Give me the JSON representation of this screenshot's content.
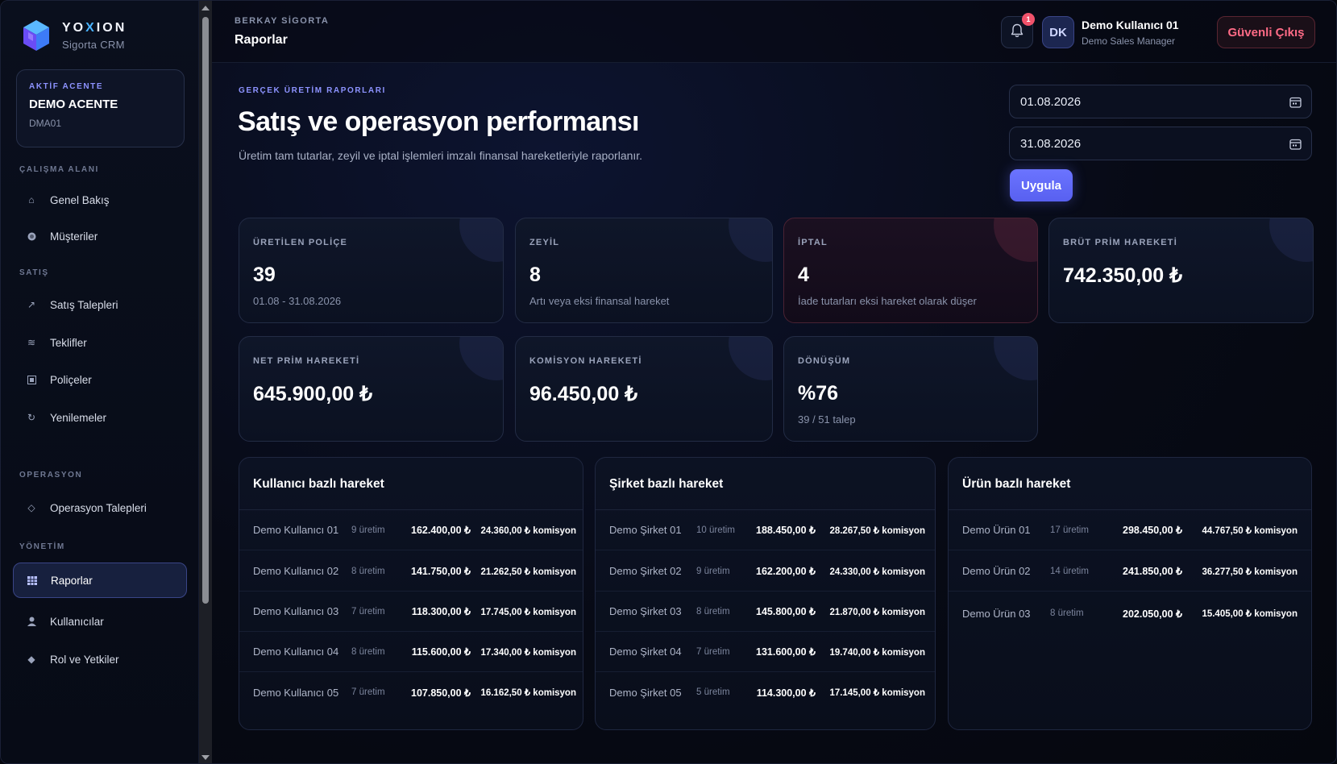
{
  "brand": {
    "name_pre": "YO",
    "name_x": "X",
    "name_post": "ION",
    "subtitle": "Sigorta CRM"
  },
  "agency": {
    "kicker": "AKTİF ACENTE",
    "name": "DEMO ACENTE",
    "code": "DMA01"
  },
  "nav": {
    "sections": [
      {
        "label": "ÇALIŞMA ALANI"
      },
      {
        "label": "SATIŞ"
      },
      {
        "label": "OPERASYON"
      },
      {
        "label": "YÖNETİM"
      }
    ],
    "items": [
      {
        "label": "Genel Bakış",
        "icon": "home-icon"
      },
      {
        "label": "Müşteriler",
        "icon": "customers-icon"
      },
      {
        "label": "Satış Talepleri",
        "icon": "trend-arrow-icon"
      },
      {
        "label": "Teklifler",
        "icon": "wave-icon"
      },
      {
        "label": "Poliçeler",
        "icon": "document-icon"
      },
      {
        "label": "Yenilemeler",
        "icon": "refresh-icon"
      },
      {
        "label": "Operasyon Talepleri",
        "icon": "diamond-icon"
      },
      {
        "label": "Raporlar",
        "icon": "report-grid-icon",
        "active": true
      },
      {
        "label": "Kullanıcılar",
        "icon": "user-icon"
      },
      {
        "label": "Rol ve Yetkiler",
        "icon": "roles-diamond-icon"
      }
    ]
  },
  "topbar": {
    "kicker": "BERKAY SİGORTA",
    "title": "Raporlar",
    "notification_count": "1",
    "user": {
      "initials": "DK",
      "name": "Demo Kullanıcı 01",
      "role": "Demo Sales Manager"
    },
    "logout_label": "Güvenli Çıkış"
  },
  "header": {
    "kicker": "GERÇEK ÜRETİM RAPORLARI",
    "title": "Satış ve operasyon performansı",
    "lead": "Üretim tam tutarlar, zeyil ve iptal işlemleri imzalı finansal hareketleriyle raporlanır."
  },
  "filters": {
    "start_date": "01.08.2026",
    "end_date": "31.08.2026",
    "apply_label": "Uygula"
  },
  "stats": [
    {
      "label": "ÜRETİLEN POLİÇE",
      "value": "39",
      "note": "01.08 - 31.08.2026"
    },
    {
      "label": "ZEYİL",
      "value": "8",
      "note": "Artı veya eksi finansal hareket"
    },
    {
      "label": "İPTAL",
      "value": "4",
      "note": "İade tutarları eksi hareket olarak düşer"
    },
    {
      "label": "BRÜT PRİM HAREKETİ",
      "value": "742.350,00 ₺",
      "note": ""
    },
    {
      "label": "NET PRİM HAREKETİ",
      "value": "645.900,00 ₺",
      "note": ""
    },
    {
      "label": "KOMİSYON HAREKETİ",
      "value": "96.450,00 ₺",
      "note": ""
    },
    {
      "label": "DÖNÜŞÜM",
      "value": "%76",
      "note": "39 / 51 talep"
    }
  ],
  "panels": [
    {
      "title": "Kullanıcı bazlı hareket",
      "rows": [
        {
          "name": "Demo Kullanıcı 01",
          "count": "9 üretim",
          "amount": "162.400,00 ₺",
          "commission": "24.360,00 ₺ komisyon"
        },
        {
          "name": "Demo Kullanıcı 02",
          "count": "8 üretim",
          "amount": "141.750,00 ₺",
          "commission": "21.262,50 ₺ komisyon"
        },
        {
          "name": "Demo Kullanıcı 03",
          "count": "7 üretim",
          "amount": "118.300,00 ₺",
          "commission": "17.745,00 ₺ komisyon"
        },
        {
          "name": "Demo Kullanıcı 04",
          "count": "8 üretim",
          "amount": "115.600,00 ₺",
          "commission": "17.340,00 ₺ komisyon"
        },
        {
          "name": "Demo Kullanıcı 05",
          "count": "7 üretim",
          "amount": "107.850,00 ₺",
          "commission": "16.162,50 ₺ komisyon"
        }
      ]
    },
    {
      "title": "Şirket bazlı hareket",
      "rows": [
        {
          "name": "Demo Şirket 01",
          "count": "10 üretim",
          "amount": "188.450,00 ₺",
          "commission": "28.267,50 ₺ komisyon"
        },
        {
          "name": "Demo Şirket 02",
          "count": "9 üretim",
          "amount": "162.200,00 ₺",
          "commission": "24.330,00 ₺ komisyon"
        },
        {
          "name": "Demo Şirket 03",
          "count": "8 üretim",
          "amount": "145.800,00 ₺",
          "commission": "21.870,00 ₺ komisyon"
        },
        {
          "name": "Demo Şirket 04",
          "count": "7 üretim",
          "amount": "131.600,00 ₺",
          "commission": "19.740,00 ₺ komisyon"
        },
        {
          "name": "Demo Şirket 05",
          "count": "5 üretim",
          "amount": "114.300,00 ₺",
          "commission": "17.145,00 ₺ komisyon"
        }
      ]
    },
    {
      "title": "Ürün bazlı hareket",
      "rows": [
        {
          "name": "Demo Ürün 01",
          "count": "17 üretim",
          "amount": "298.450,00 ₺",
          "commission": "44.767,50 ₺ komisyon"
        },
        {
          "name": "Demo Ürün 02",
          "count": "14 üretim",
          "amount": "241.850,00 ₺",
          "commission": "36.277,50 ₺ komisyon"
        },
        {
          "name": "Demo Ürün 03",
          "count": "8 üretim",
          "amount": "202.050,00 ₺",
          "commission": "15.405,00 ₺ komisyon"
        }
      ]
    }
  ],
  "colors": {
    "accent": "#6b74ff",
    "danger": "#ff6b86",
    "background": "#060913"
  }
}
